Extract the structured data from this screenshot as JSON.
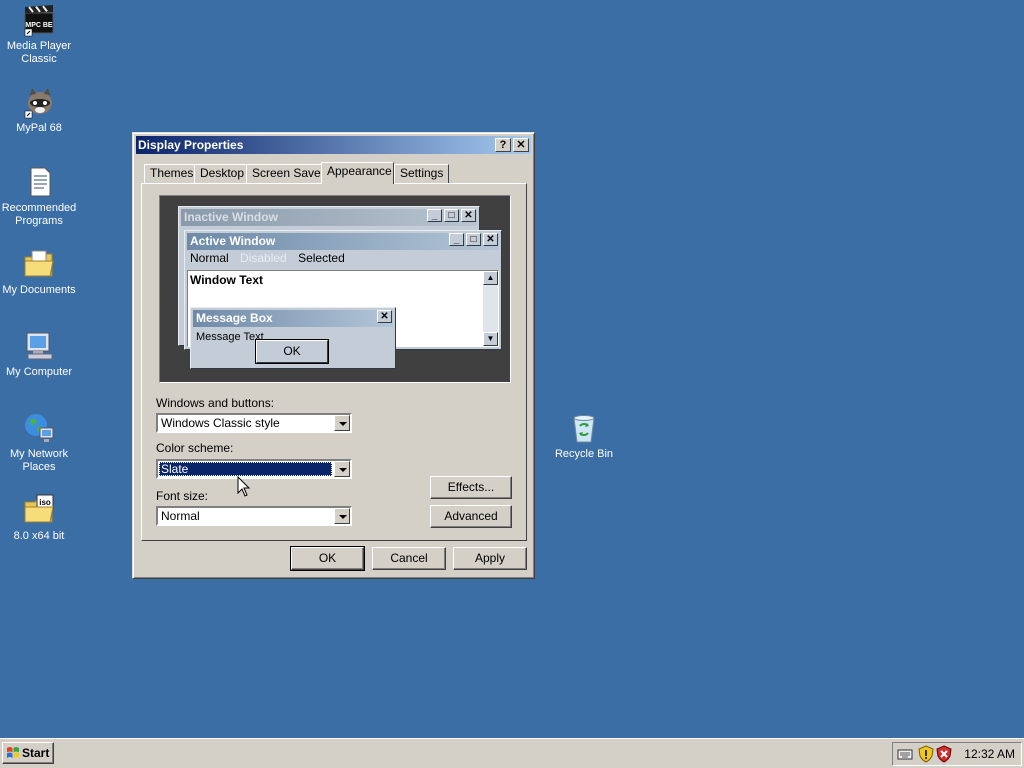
{
  "desktop": {
    "icons": [
      {
        "label": "Media Player Classic",
        "icon": "media-player-icon",
        "badge": "MPC BE"
      },
      {
        "label": "MyPal 68",
        "icon": "raccoon-browser-icon"
      },
      {
        "label": "Recommended Programs",
        "icon": "document-icon"
      },
      {
        "label": "My Documents",
        "icon": "folder-document-icon"
      },
      {
        "label": "My Computer",
        "icon": "computer-icon"
      },
      {
        "label": "My Network Places",
        "icon": "network-globe-icon"
      },
      {
        "label": "8.0 x64 bit",
        "icon": "iso-folder-icon",
        "badge": "iso"
      },
      {
        "label": "Recycle Bin",
        "icon": "recycle-bin-icon"
      }
    ]
  },
  "dialog": {
    "title": "Display Properties",
    "help_btn": "?",
    "close_btn": "✕",
    "tabs": [
      "Themes",
      "Desktop",
      "Screen Saver",
      "Appearance",
      "Settings"
    ],
    "active_tab": "Appearance",
    "preview": {
      "inactive_title": "Inactive Window",
      "active_title": "Active Window",
      "menu_normal": "Normal",
      "menu_disabled": "Disabled",
      "menu_selected": "Selected",
      "window_text": "Window Text",
      "msgbox_title": "Message Box",
      "msgbox_text": "Message Text",
      "msgbox_ok": "OK"
    },
    "windows_buttons_label": "Windows and buttons:",
    "windows_buttons_value": "Windows Classic style",
    "color_scheme_label": "Color scheme:",
    "color_scheme_value": "Slate",
    "font_size_label": "Font size:",
    "font_size_value": "Normal",
    "effects_btn": "Effects...",
    "advanced_btn": "Advanced",
    "ok_btn": "OK",
    "cancel_btn": "Cancel",
    "apply_btn": "Apply"
  },
  "taskbar": {
    "start_label": "Start",
    "clock": "12:32 AM",
    "tray_icons": [
      "keyboard-icon",
      "security-shield-icon",
      "antivirus-shield-icon"
    ]
  },
  "colors": {
    "desktop_bg": "#3a6ea5",
    "selection": "#0a246a",
    "slate_caption": "#6e8aa8"
  }
}
